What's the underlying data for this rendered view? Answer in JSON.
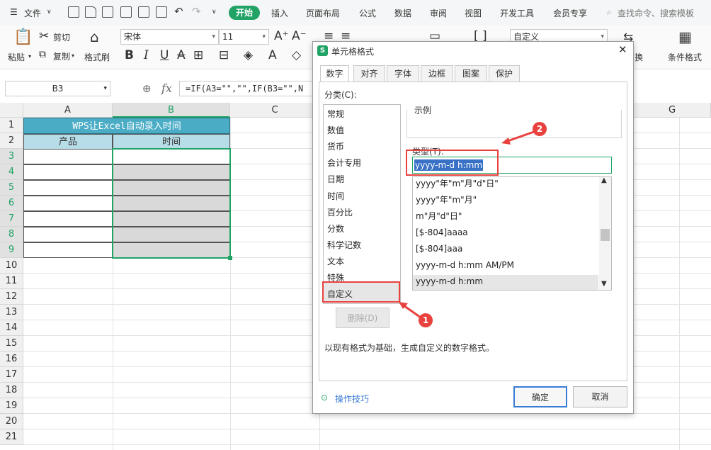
{
  "menubar": {
    "file": "文件",
    "tabs": [
      "开始",
      "插入",
      "页面布局",
      "公式",
      "数据",
      "审阅",
      "视图",
      "开发工具",
      "会员专享"
    ],
    "search": "查找命令、搜索模板"
  },
  "ribbon": {
    "paste": "粘贴",
    "cut": "剪切",
    "copy": "复制",
    "format_painter": "格式刷",
    "font_name": "宋体",
    "font_size": "11",
    "number_format": "自定义",
    "conditional_format": "条件格式",
    "convert": "换"
  },
  "formula_bar": {
    "name_box": "B3",
    "fx": "fx",
    "formula": "=IF(A3=\"\",\"\",IF(B3=\"\",N"
  },
  "sheet": {
    "columns": [
      "A",
      "B",
      "C",
      "G"
    ],
    "rows": [
      "1",
      "2",
      "3",
      "4",
      "5",
      "6",
      "7",
      "8",
      "9",
      "10",
      "11",
      "12",
      "13",
      "14",
      "15",
      "16",
      "17",
      "18",
      "19",
      "20",
      "21"
    ],
    "title": "WPS让Excel自动录入时间",
    "header_a": "产品",
    "header_b": "时间"
  },
  "dialog": {
    "title": "单元格格式",
    "close": "✕",
    "tabs": [
      "数字",
      "对齐",
      "字体",
      "边框",
      "图案",
      "保护"
    ],
    "category_label": "分类(C):",
    "categories": [
      "常规",
      "数值",
      "货币",
      "会计专用",
      "日期",
      "时间",
      "百分比",
      "分数",
      "科学记数",
      "文本",
      "特殊",
      "自定义"
    ],
    "sample_label": "示例",
    "type_label": "类型(T):",
    "type_value": "yyyy-m-d h:mm",
    "type_list": [
      "yyyy\"年\"m\"月\"d\"日\"",
      "yyyy\"年\"m\"月\"",
      "m\"月\"d\"日\"",
      "[$-804]aaaa",
      "[$-804]aaa",
      "yyyy-m-d h:mm AM/PM",
      "yyyy-m-d h:mm"
    ],
    "delete": "删除(D)",
    "description": "以现有格式为基础，生成自定义的数字格式。",
    "tips": "操作技巧",
    "ok": "确定",
    "cancel": "取消"
  },
  "annotations": {
    "marker1": "1",
    "marker2": "2"
  },
  "colors": {
    "accent": "#21a366",
    "title_fill": "#4bacc6",
    "header_fill": "#b7dee8",
    "selection": "#d9d9d9",
    "marker": "#e8413e"
  }
}
